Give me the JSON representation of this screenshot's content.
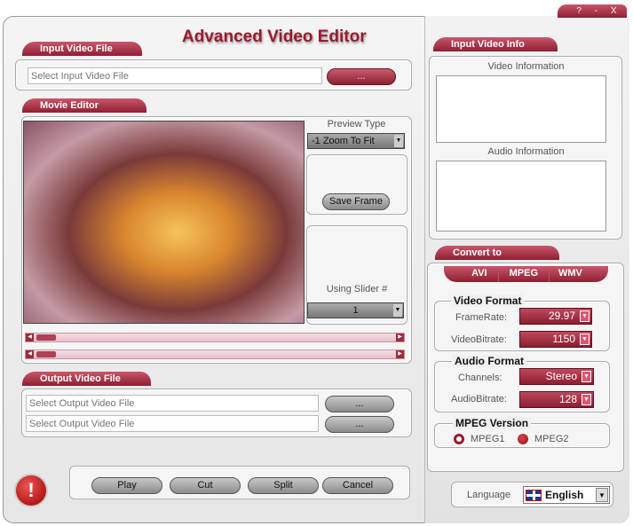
{
  "window": {
    "title": "Advanced Video Editor",
    "controls": [
      "?",
      "-",
      "X"
    ]
  },
  "input_file": {
    "tab": "Input Video File",
    "placeholder": "Select Input Video File",
    "browse": "..."
  },
  "movie_editor": {
    "tab": "Movie Editor",
    "preview_type_label": "Preview Type",
    "preview_type": "-1 Zoom To Fit",
    "save_frame": "Save Frame",
    "slider_label": "Using Slider #",
    "slider_value": "1"
  },
  "output_file": {
    "tab": "Output Video File",
    "placeholders": [
      "Select Output Video File",
      "Select Output Video File"
    ],
    "browse": "..."
  },
  "controls": {
    "play": "Play",
    "cut": "Cut",
    "split": "Split",
    "cancel": "Cancel"
  },
  "info": {
    "tab": "Input Video Info",
    "video": "Video Information",
    "audio": "Audio Information"
  },
  "convert": {
    "tab": "Convert to",
    "formats": [
      "AVI",
      "MPEG",
      "WMV"
    ],
    "video_format": "Video Format",
    "framerate_label": "FrameRate:",
    "framerate": "29.97",
    "vbitrate_label": "VideoBitrate:",
    "vbitrate": "1150",
    "audio_format": "Audio Format",
    "channels_label": "Channels:",
    "channels": "Stereo",
    "abitrate_label": "AudioBitrate:",
    "abitrate": "128",
    "mpeg_version": "MPEG Version",
    "mpeg1": "MPEG1",
    "mpeg2": "MPEG2",
    "selected": "MPEG1"
  },
  "language": {
    "label": "Language",
    "value": "English"
  },
  "colors": {
    "accent": "#a0283c"
  }
}
